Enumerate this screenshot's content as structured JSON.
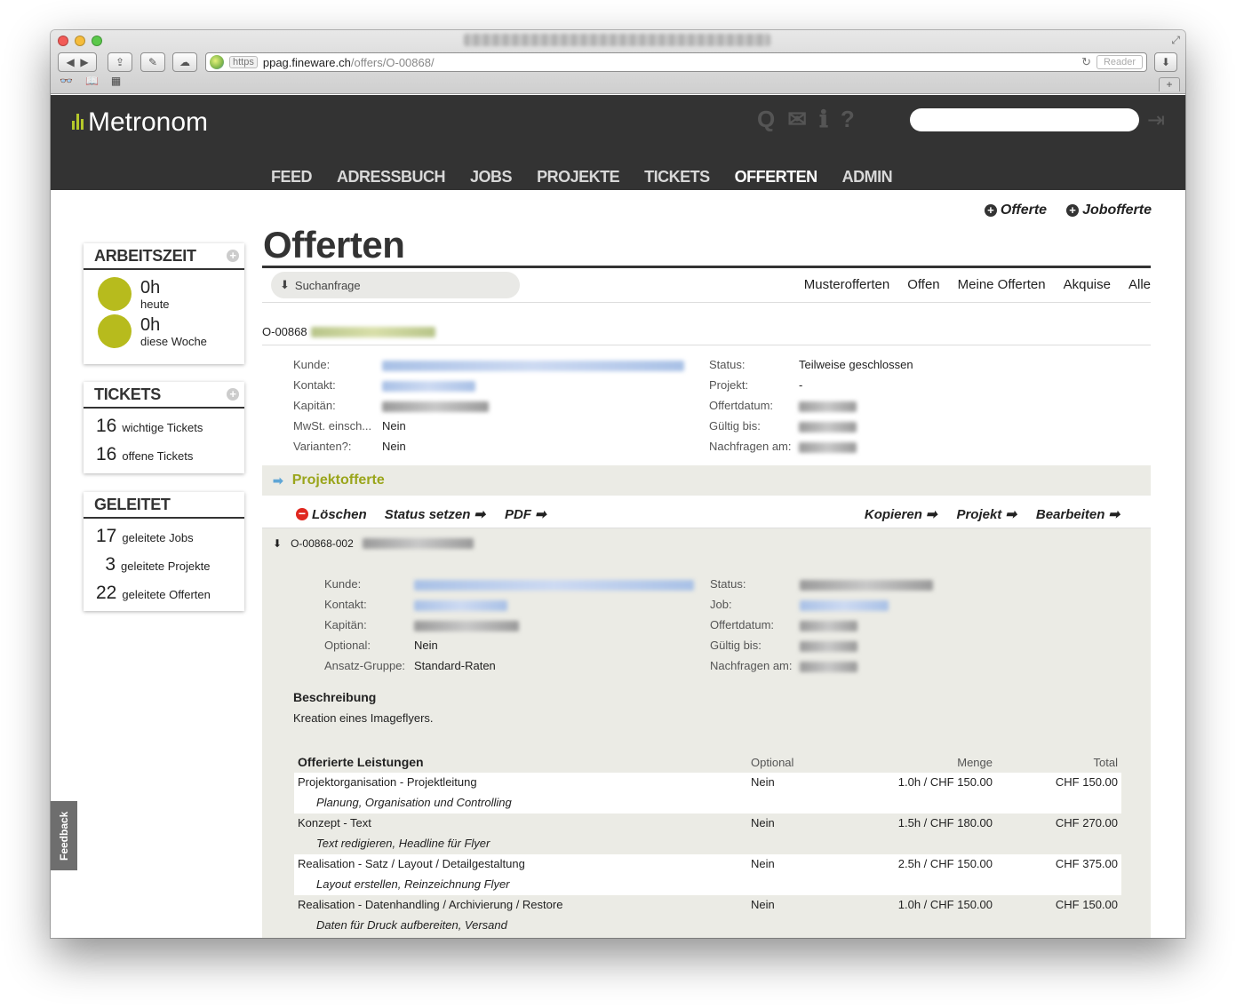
{
  "browser": {
    "https_label": "https",
    "url_host": "ppag.fineware.ch",
    "url_path": "/offers/O-00868/",
    "reader_label": "Reader",
    "bookmark_icons": [
      "reading-list-icon",
      "bookmarks-icon",
      "top-sites-icon"
    ]
  },
  "app": {
    "logo": "Metronom",
    "nav": [
      "FEED",
      "ADRESSBUCH",
      "JOBS",
      "PROJEKTE",
      "TICKETS",
      "OFFERTEN",
      "ADMIN"
    ],
    "active_nav": "OFFERTEN",
    "header_icons": [
      "search-icon",
      "chat-icon",
      "info-icon",
      "help-icon",
      "logout-icon"
    ],
    "accent_color": "#b7bb1d"
  },
  "quicklinks": {
    "offerte": "Offerte",
    "jobofferte": "Jobofferte"
  },
  "sidebar": {
    "arbeitszeit": {
      "title": "ARBEITSZEIT",
      "rows": [
        {
          "value": "0h",
          "label": "heute"
        },
        {
          "value": "0h",
          "label": "diese Woche"
        }
      ]
    },
    "tickets": {
      "title": "TICKETS",
      "rows": [
        {
          "count": "16",
          "label": "wichtige Tickets"
        },
        {
          "count": "16",
          "label": "offene Tickets"
        }
      ]
    },
    "geleitet": {
      "title": "GELEITET",
      "rows": [
        {
          "count": "17",
          "label": "geleitete Jobs"
        },
        {
          "count": "3",
          "label": "geleitete Projekte"
        },
        {
          "count": "22",
          "label": "geleitete Offerten"
        }
      ]
    }
  },
  "page": {
    "title": "Offerten",
    "search_label": "Suchanfrage",
    "filters": [
      "Musterofferten",
      "Offen",
      "Meine Offerten",
      "Akquise",
      "Alle"
    ]
  },
  "offer": {
    "number": "O-00868",
    "left": [
      {
        "key": "Kunde:",
        "value": ""
      },
      {
        "key": "Kontakt:",
        "value": ""
      },
      {
        "key": "Kapitän:",
        "value": ""
      },
      {
        "key": "MwSt. einsch...",
        "value": "Nein"
      },
      {
        "key": "Varianten?:",
        "value": "Nein"
      }
    ],
    "right": [
      {
        "key": "Status:",
        "value": "Teilweise geschlossen"
      },
      {
        "key": "Projekt:",
        "value": "-"
      },
      {
        "key": "Offertdatum:",
        "value": ""
      },
      {
        "key": "Gültig bis:",
        "value": ""
      },
      {
        "key": "Nachfragen am:",
        "value": ""
      }
    ]
  },
  "projektofferte": {
    "label": "Projektofferte",
    "actions_left": [
      "Löschen",
      "Status setzen",
      "PDF"
    ],
    "actions_right": [
      "Kopieren",
      "Projekt",
      "Bearbeiten"
    ]
  },
  "variant": {
    "number": "O-00868-002",
    "left": [
      {
        "key": "Kunde:",
        "value": ""
      },
      {
        "key": "Kontakt:",
        "value": ""
      },
      {
        "key": "Kapitän:",
        "value": ""
      },
      {
        "key": "Optional:",
        "value": "Nein"
      },
      {
        "key": "Ansatz-Gruppe:",
        "value": "Standard-Raten"
      }
    ],
    "right": [
      {
        "key": "Status:",
        "value": ""
      },
      {
        "key": "Job:",
        "value": ""
      },
      {
        "key": "Offertdatum:",
        "value": ""
      },
      {
        "key": "Gültig bis:",
        "value": ""
      },
      {
        "key": "Nachfragen am:",
        "value": ""
      }
    ],
    "description_title": "Beschreibung",
    "description": "Kreation eines Imageflyers."
  },
  "services": {
    "headers": [
      "Offerierte Leistungen",
      "Optional",
      "Menge",
      "Total"
    ],
    "rows": [
      {
        "name": "Projektorganisation - Projektleitung",
        "optional": "Nein",
        "menge": "1.0h / CHF 150.00",
        "total": "CHF 150.00",
        "sub": "Planung, Organisation und Controlling"
      },
      {
        "name": "Konzept - Text",
        "optional": "Nein",
        "menge": "1.5h / CHF 180.00",
        "total": "CHF 270.00",
        "sub": "Text redigieren, Headline für Flyer"
      },
      {
        "name": "Realisation - Satz / Layout / Detailgestaltung",
        "optional": "Nein",
        "menge": "2.5h / CHF 150.00",
        "total": "CHF 375.00",
        "sub": "Layout erstellen, Reinzeichnung Flyer"
      },
      {
        "name": "Realisation - Datenhandling / Archivierung / Restore",
        "optional": "Nein",
        "menge": "1.0h / CHF 150.00",
        "total": "CHF 150.00",
        "sub": "Daten für Druck aufbereiten, Versand"
      }
    ]
  },
  "feedback_label": "Feedback"
}
